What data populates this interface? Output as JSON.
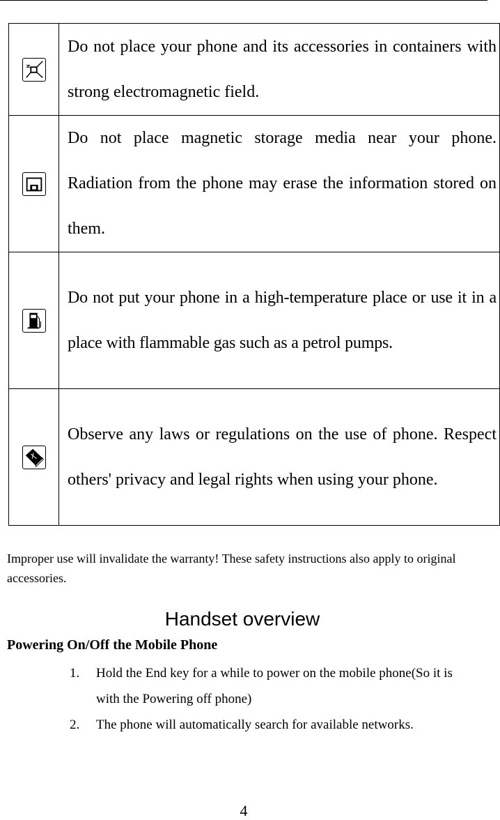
{
  "safety_table": {
    "rows": [
      {
        "icon": "electromagnetic-field-icon",
        "text": "Do not place your phone and its accessories in containers with strong electromagnetic field."
      },
      {
        "icon": "floppy-disk-icon",
        "text": "Do not place magnetic storage media near your phone. Radiation from the phone may erase the information stored on them."
      },
      {
        "icon": "fuel-pump-icon",
        "text": "Do not put your phone in a high-temperature place or use it in a place with flammable gas such as a petrol pumps."
      },
      {
        "icon": "law-book-icon",
        "text": "Observe any laws or regulations on the use of phone. Respect others' privacy and legal rights when using your phone."
      }
    ]
  },
  "warranty_note": "Improper use will invalidate the warranty! These safety instructions also apply to original accessories.",
  "section_title": "Handset overview",
  "subsection_title": "Powering On/Off the Mobile Phone",
  "steps": [
    {
      "num": "1.",
      "text": "Hold the End key for a while to power on the mobile phone(So it is with the Powering off phone)"
    },
    {
      "num": "2.",
      "text": "The phone will automatically search for available networks."
    }
  ],
  "page_number": "4"
}
